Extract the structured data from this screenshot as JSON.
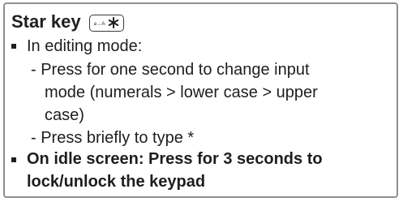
{
  "card": {
    "title": "Star key",
    "key_icon": {
      "small_text": "a→A",
      "glyph": "asterisk-icon"
    },
    "bullet1": {
      "text": "In editing mode:",
      "sub1_line1": "- Press for one second to change input",
      "sub1_line2": "mode (numerals > lower case > upper",
      "sub1_line3": "case)",
      "sub2": "- Press briefly to type *"
    },
    "bullet2": {
      "line1": "On idle screen:  Press for 3 seconds to",
      "line2": "lock/unlock the keypad"
    }
  }
}
